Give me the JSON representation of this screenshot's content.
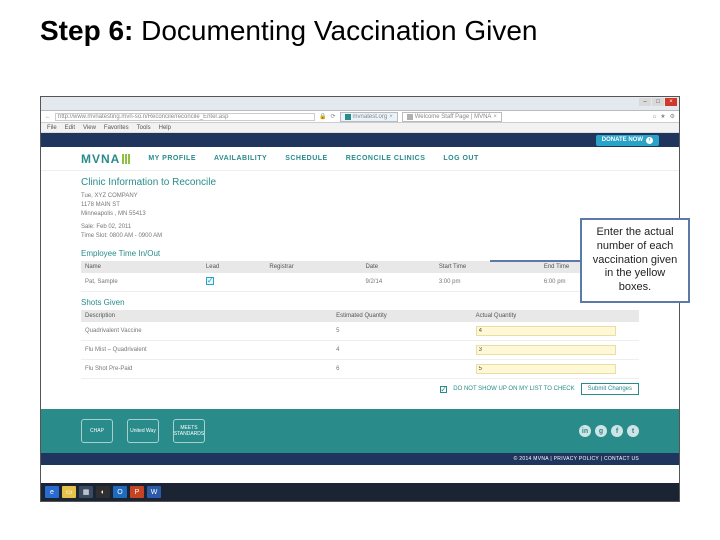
{
  "title_bold": "Step 6:",
  "title_rest": " Documenting Vaccination Given",
  "browser": {
    "address": "http://www.mvnatesting.mvn-so.n/Reconcile/reconcile_Enter.asp",
    "tab1": "mvnatest.org",
    "tab2": "Welcome Staff Page | MVNA",
    "menu": [
      "File",
      "Edit",
      "View",
      "Favorites",
      "Tools",
      "Help"
    ]
  },
  "donate": "DONATE NOW",
  "logo": "MVNA",
  "nav": [
    "MY PROFILE",
    "AVAILABILITY",
    "SCHEDULE",
    "RECONCILE CLINICS",
    "LOG OUT"
  ],
  "section_title": "Clinic Information to Reconcile",
  "clinic": {
    "line1": "Tue, XYZ COMPANY",
    "line2": "1178 MAIN ST",
    "line3": "Minneapolis , MN 55413",
    "line4": "Sale: Feb 02, 2011",
    "line5": "Time Slot: 0800 AM - 0900 AM"
  },
  "emp_title": "Employee Time In/Out",
  "emp_headers": [
    "Name",
    "Lead",
    "Registrar",
    "Date",
    "Start Time",
    "End Time"
  ],
  "emp_row": {
    "name": "Pat, Sample",
    "date": "9/2/14",
    "start": "3:00 pm",
    "end": "6:00 pm"
  },
  "shots_title": "Shots Given",
  "shots_headers": [
    "Description",
    "Estimated Quantity",
    "Actual Quantity"
  ],
  "shots_rows": [
    {
      "desc": "Quadrivalent Vaccine",
      "est": "5",
      "act": "4"
    },
    {
      "desc": "Flu Mist – Quadrivalent",
      "est": "4",
      "act": "3"
    },
    {
      "desc": "Flu Shot Pre-Paid",
      "est": "6",
      "act": "5"
    }
  ],
  "save_label": "DO NOT SHOW UP ON MY LIST TO CHECK",
  "submit": "Submit Changes",
  "footer_logos": [
    "CHAP",
    "United Way",
    "MEETS STANDARDS"
  ],
  "copyright": "© 2014 MVNA | PRIVACY POLICY | CONTACT US",
  "callout": "Enter the actual number of each vaccination given in the yellow boxes."
}
